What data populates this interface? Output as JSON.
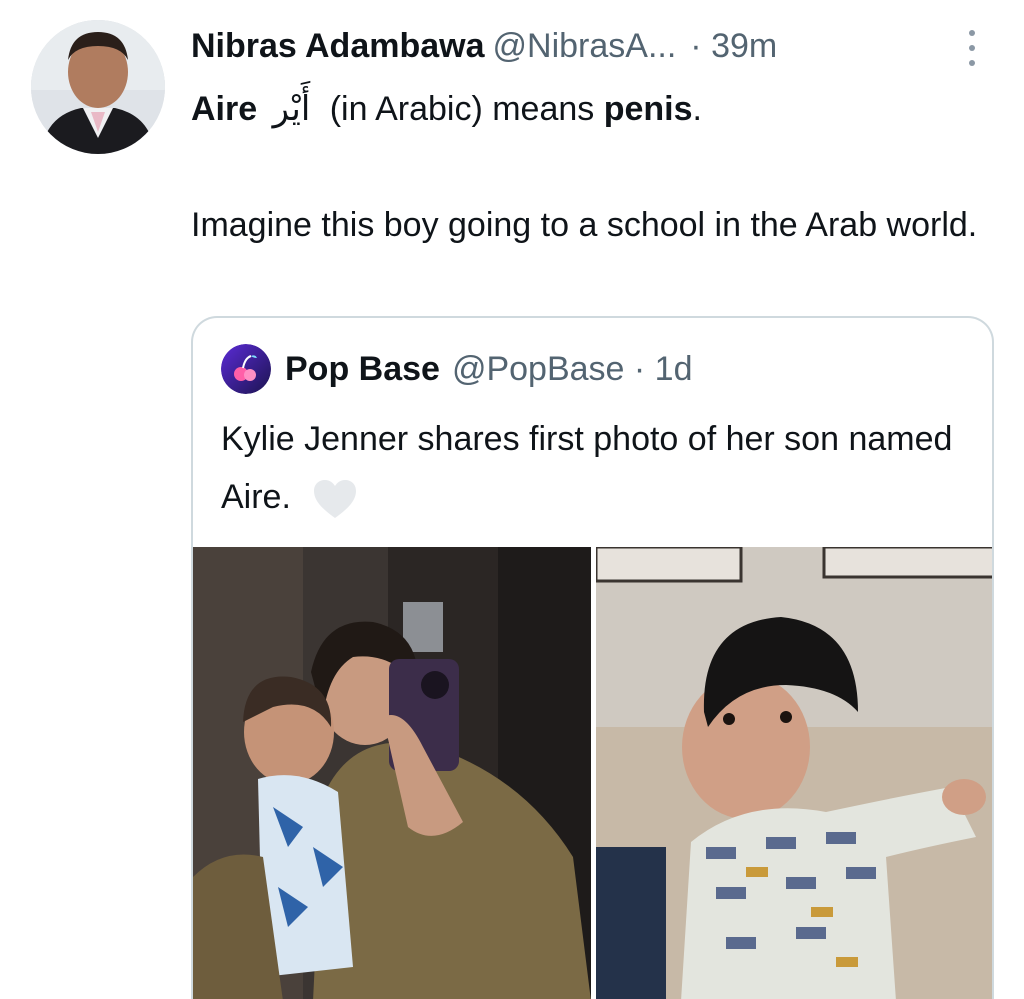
{
  "tweet": {
    "author_name": "Nibras Adambawa",
    "author_handle": "@NibrasA...",
    "separator": "·",
    "time": "39m",
    "line1_bold_word": "Aire",
    "line1_arabic": "أَيْر",
    "line1_middle": "(in Arabic) means",
    "line1_bold_end": "penis",
    "line1_period": ".",
    "paragraph2": "Imagine this boy going to a school in the Arab world."
  },
  "quoted_tweet": {
    "author_name": "Pop Base",
    "author_handle": "@PopBase · 1d",
    "text": "Kylie Jenner shares first photo of her son named Aire."
  },
  "icons": {
    "more": "more-options-icon",
    "heart": "heart-emoji-icon"
  },
  "colors": {
    "text": "#0f1419",
    "secondary": "#536471",
    "border": "#cfd9de"
  }
}
